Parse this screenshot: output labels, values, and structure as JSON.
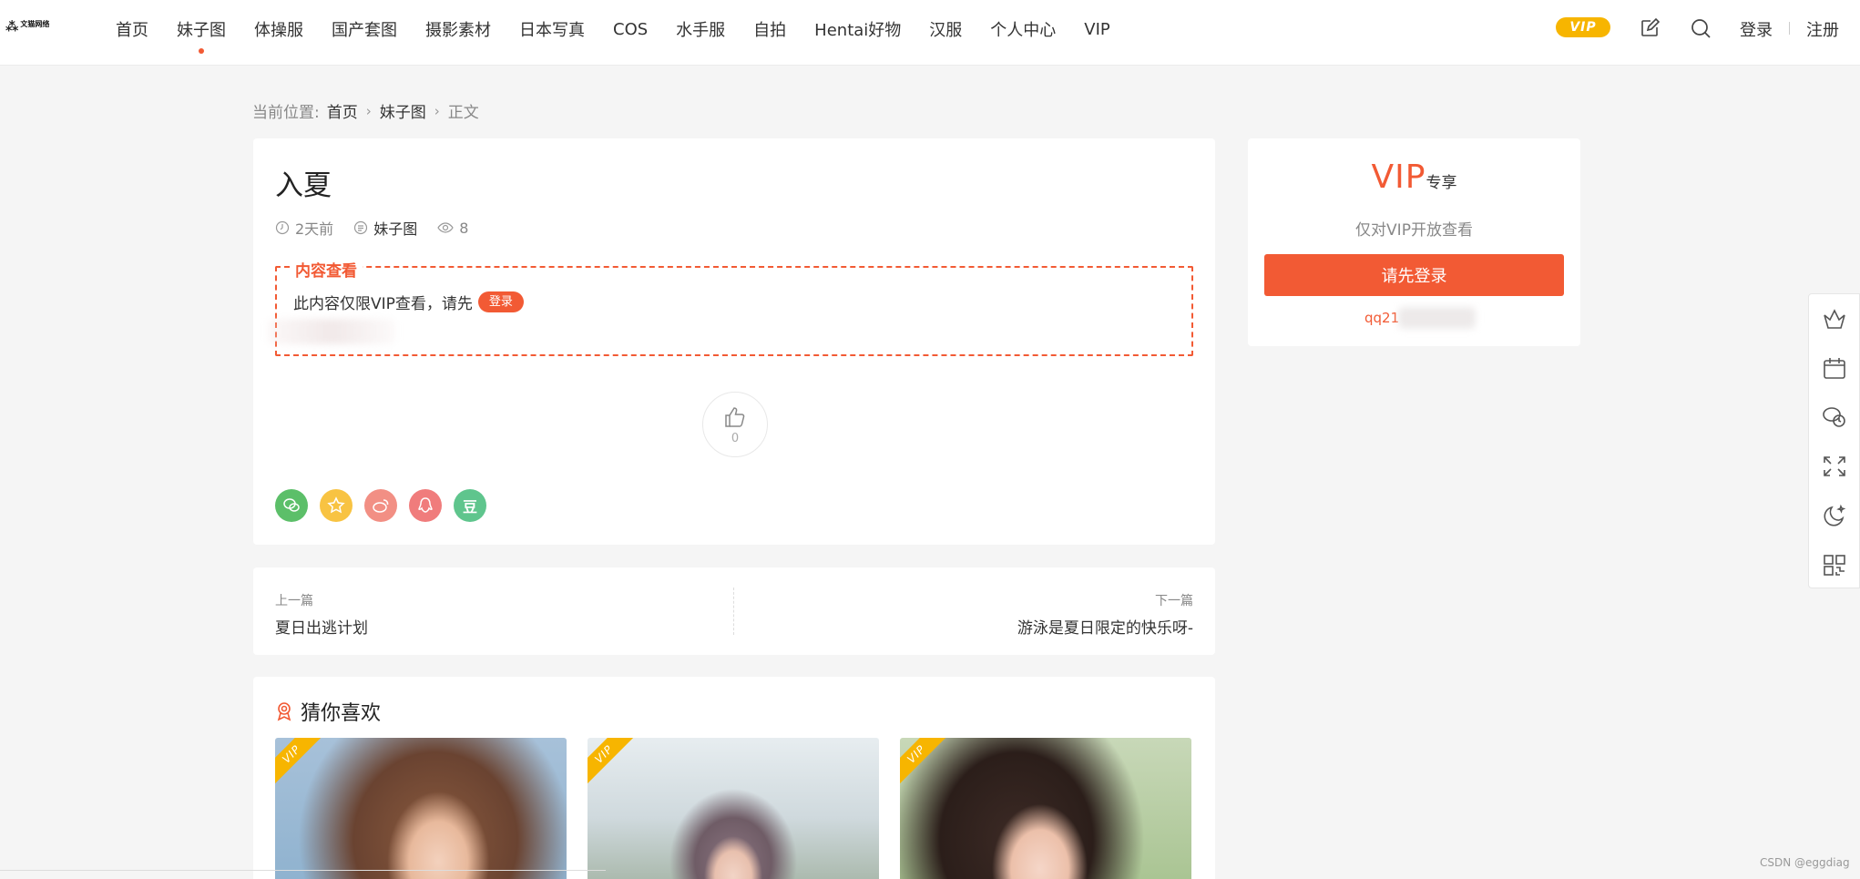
{
  "header": {
    "logo_text": "文猫网络",
    "nav": [
      {
        "label": "首页",
        "active": false
      },
      {
        "label": "妹子图",
        "active": true
      },
      {
        "label": "体操服",
        "active": false
      },
      {
        "label": "国产套图",
        "active": false
      },
      {
        "label": "摄影素材",
        "active": false
      },
      {
        "label": "日本写真",
        "active": false
      },
      {
        "label": "COS",
        "active": false
      },
      {
        "label": "水手服",
        "active": false
      },
      {
        "label": "自拍",
        "active": false
      },
      {
        "label": "Hentai好物",
        "active": false
      },
      {
        "label": "汉服",
        "active": false
      },
      {
        "label": "个人中心",
        "active": false
      },
      {
        "label": "VIP",
        "active": false
      }
    ],
    "vip_badge": "VIP",
    "login": "登录",
    "register": "注册"
  },
  "breadcrumb": {
    "prefix": "当前位置:",
    "items": [
      "首页",
      "妹子图",
      "正文"
    ]
  },
  "article": {
    "title": "入夏",
    "time": "2天前",
    "category": "妹子图",
    "views": "8",
    "vip_box": {
      "legend": "内容查看",
      "message": "此内容仅限VIP查看，请先",
      "login_button": "登录"
    },
    "likes": "0",
    "share_icons": [
      "wechat-icon",
      "qzone-icon",
      "weibo-icon",
      "qq-icon",
      "douban-icon"
    ],
    "share_douban_glyph": "豆"
  },
  "post_nav": {
    "prev_label": "上一篇",
    "prev_title": "夏日出逃计划",
    "next_label": "下一篇",
    "next_title": "游泳是夏日限定的快乐呀-"
  },
  "recommend": {
    "title": "猜你喜欢",
    "ribbon": "VIP"
  },
  "vip_card": {
    "title": "VIP",
    "title_suffix": "专享",
    "desc": "仅对VIP开放查看",
    "login_button": "请先登录",
    "qq_prefix": "qq21"
  },
  "watermark": "CSDN @eggdiag",
  "colors": {
    "accent": "#f25a34",
    "vip_gold": "#f7b500"
  }
}
